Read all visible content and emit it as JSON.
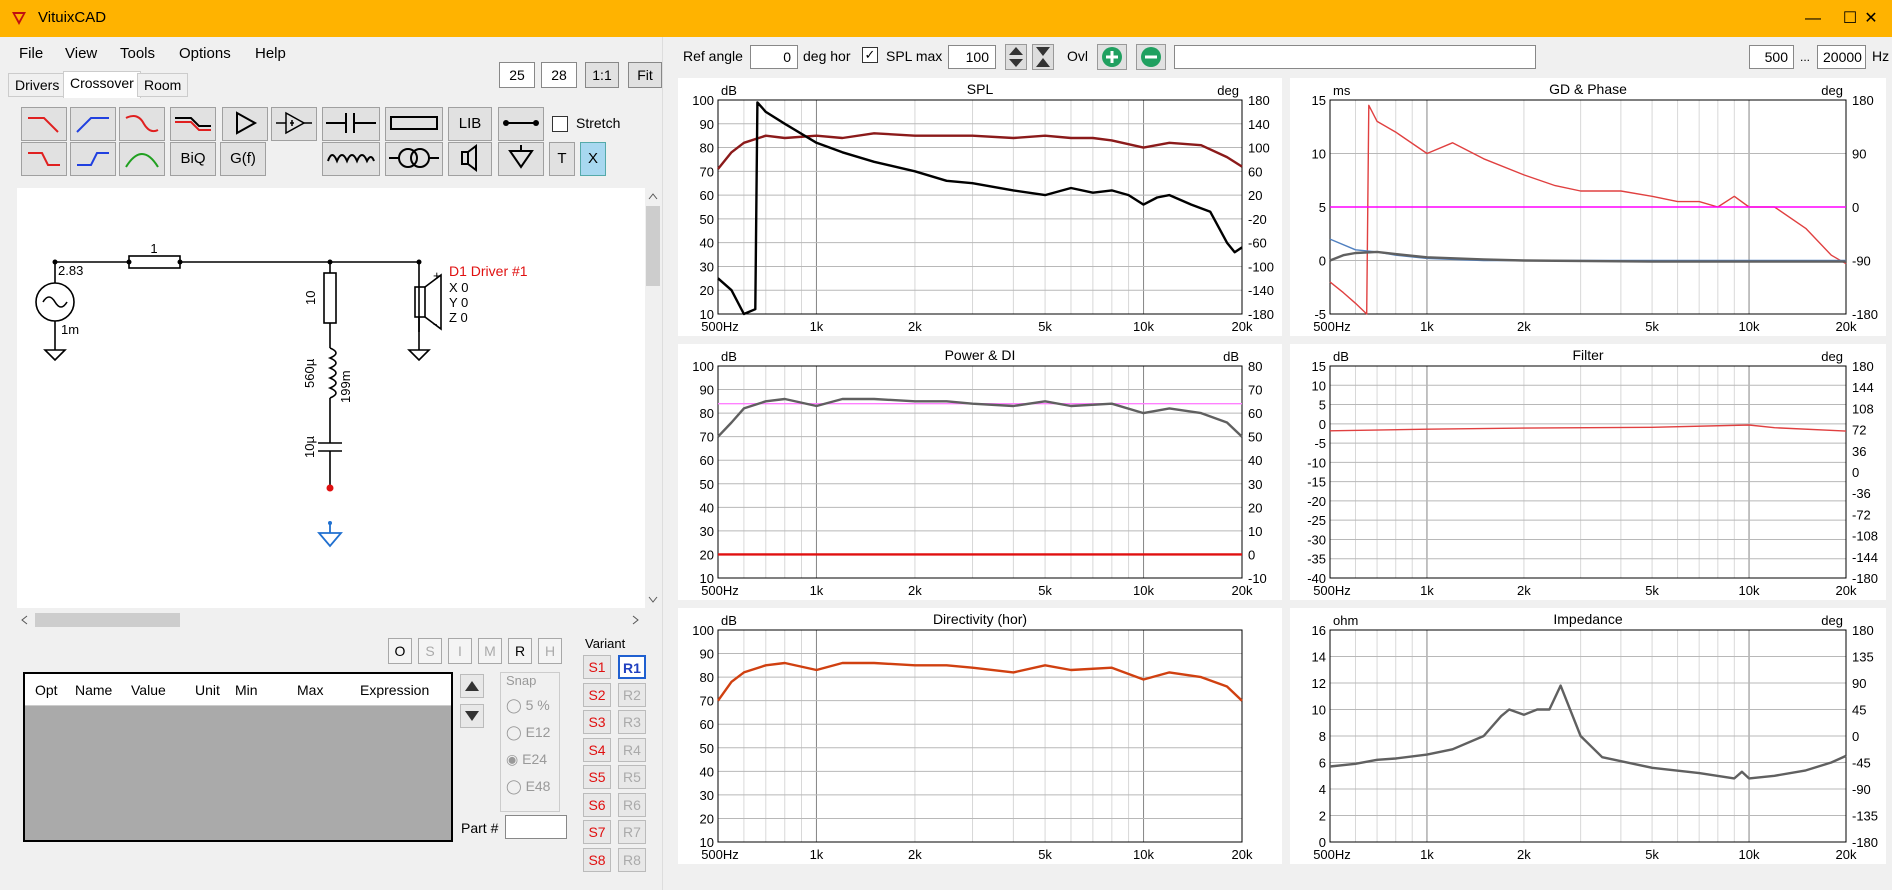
{
  "app": {
    "title": "VituixCAD",
    "brand_color": "#FFB300"
  },
  "window_controls": [
    "—",
    "☐",
    "✕"
  ],
  "menu": [
    "File",
    "View",
    "Tools",
    "Options",
    "Help"
  ],
  "tabs": [
    "Drivers",
    "Crossover",
    "Room"
  ],
  "active_tab": "Crossover",
  "view_boxes": {
    "a": "25",
    "b": "28",
    "one_to_one": "1:1",
    "fit": "Fit"
  },
  "toolbar": {
    "biq": "BiQ",
    "gf": "G(f)",
    "lib": "LIB",
    "t": "T",
    "x": "X",
    "stretch": "Stretch"
  },
  "schematic": {
    "source_voltage": "2.83",
    "source_impedance": "1m",
    "r_series": "1",
    "r_shunt": "10",
    "l_shunt": "560µ",
    "l_dcr": "199m",
    "c_shunt": "10µ",
    "driver": {
      "label": "D1 Driver #1",
      "x": "X 0",
      "y": "Y 0",
      "z": "Z 0",
      "plus": "+",
      "minus": "-"
    }
  },
  "mode_buttons": [
    "O",
    "S",
    "I",
    "M",
    "R",
    "H"
  ],
  "optimizer": {
    "columns": [
      "Opt",
      "Name",
      "Value",
      "Unit",
      "Min",
      "Max",
      "Expression"
    ]
  },
  "snap": {
    "label": "Snap",
    "options": [
      "5 %",
      "E12",
      "E24",
      "E48"
    ],
    "selected": "E24"
  },
  "part_label": "Part #",
  "variant": {
    "label": "Variant",
    "s": [
      "S1",
      "S2",
      "S3",
      "S4",
      "S5",
      "S6",
      "S7",
      "S8"
    ],
    "r": [
      "R1",
      "R2",
      "R3",
      "R4",
      "R5",
      "R6",
      "R7",
      "R8"
    ],
    "active_r": "R1"
  },
  "top_controls": {
    "ref_angle_label": "Ref angle",
    "ref_angle": "0",
    "deg_hor": "deg hor",
    "spl_max_label": "SPL max",
    "spl_max": "100",
    "ovl": "Ovl",
    "f_min": "500",
    "ellipsis": "...",
    "f_max": "20000",
    "hz": "Hz"
  },
  "freq_ticks": [
    "500Hz",
    "1k",
    "2k",
    "5k",
    "10k",
    "20k"
  ],
  "chart_data": [
    {
      "type": "line",
      "title": "SPL",
      "ylabel": "dB",
      "y2label": "deg",
      "ylim": [
        10,
        100
      ],
      "y2lim": [
        -180,
        180
      ],
      "y_ticks": [
        "100",
        "90",
        "80",
        "70",
        "60",
        "50",
        "40",
        "30",
        "20",
        "10"
      ],
      "y2_ticks": [
        "180",
        "140",
        "100",
        "60",
        "20",
        "-20",
        "-60",
        "-100",
        "-140",
        "-180"
      ],
      "series": [
        {
          "color": "#8B1A1A",
          "x": [
            500,
            550,
            600,
            700,
            800,
            1000,
            1200,
            1500,
            2000,
            2500,
            3000,
            4000,
            5000,
            6000,
            7000,
            8000,
            10000,
            12000,
            15000,
            18000,
            20000
          ],
          "values": [
            71,
            78,
            82,
            85,
            84,
            85,
            84,
            86,
            85,
            85,
            85,
            84,
            85,
            84,
            84,
            83,
            80,
            82,
            81,
            76,
            72
          ]
        },
        {
          "color": "#000000",
          "x": [
            500,
            550,
            600,
            650,
            660,
            700,
            800,
            1000,
            1200,
            1500,
            2000,
            2500,
            3000,
            4000,
            5000,
            6000,
            7000,
            8000,
            9000,
            10000,
            11000,
            12000,
            14000,
            16000,
            18000,
            19000,
            20000
          ],
          "values": [
            25,
            20,
            10,
            12,
            99,
            95,
            90,
            82,
            78,
            74,
            70,
            66,
            65,
            62,
            60,
            63,
            61,
            62,
            60,
            56,
            59,
            60,
            56,
            53,
            40,
            36,
            38
          ]
        }
      ]
    },
    {
      "type": "line",
      "title": "GD & Phase",
      "ylabel": "ms",
      "y2label": "deg",
      "ylim": [
        -5,
        15
      ],
      "y2lim": [
        -180,
        180
      ],
      "y_ticks": [
        "15",
        "10",
        "5",
        "0",
        "-5"
      ],
      "y2_ticks": [
        "180",
        "90",
        "0",
        "-90",
        "-180"
      ],
      "series": [
        {
          "color": "#E04040",
          "x": [
            500,
            550,
            600,
            650,
            660,
            700,
            800,
            1000,
            1200,
            1500,
            2000,
            2500,
            3000,
            4000,
            5000,
            6000,
            7000,
            8000,
            9000,
            10000,
            12000,
            15000,
            18000,
            20000
          ],
          "values": [
            -2,
            -3,
            -4,
            -5,
            14.5,
            13,
            12,
            10,
            11,
            9.5,
            8,
            7,
            6.5,
            6.5,
            6,
            5.5,
            5.5,
            5,
            6,
            5,
            5,
            3,
            0.5,
            -0.3
          ]
        },
        {
          "color": "#FF00FF",
          "x": [
            500,
            20000
          ],
          "values": [
            5,
            5
          ]
        },
        {
          "color": "#5080C0",
          "x": [
            500,
            600,
            700,
            800,
            1000,
            1500,
            2000,
            5000,
            20000
          ],
          "values": [
            2,
            1,
            0.8,
            0.5,
            0.2,
            0,
            0,
            0,
            0
          ]
        },
        {
          "color": "#606060",
          "x": [
            500,
            550,
            600,
            700,
            800,
            1000,
            1500,
            2000,
            5000,
            20000
          ],
          "values": [
            0,
            0.5,
            0.7,
            0.8,
            0.6,
            0.3,
            0.1,
            0,
            -0.1,
            -0.1
          ]
        }
      ]
    },
    {
      "type": "line",
      "title": "Power & DI",
      "ylabel": "dB",
      "y2label": "dB",
      "ylim": [
        10,
        100
      ],
      "y2lim": [
        -10,
        80
      ],
      "y_ticks": [
        "100",
        "90",
        "80",
        "70",
        "60",
        "50",
        "40",
        "30",
        "20",
        "10"
      ],
      "y2_ticks": [
        "80",
        "70",
        "60",
        "50",
        "40",
        "30",
        "20",
        "10",
        "0",
        "-10"
      ],
      "series": [
        {
          "color": "#FF80FF",
          "x": [
            500,
            20000
          ],
          "values": [
            84,
            84
          ]
        },
        {
          "color": "#606060",
          "x": [
            500,
            550,
            600,
            700,
            800,
            1000,
            1200,
            1500,
            2000,
            2500,
            3000,
            4000,
            5000,
            6000,
            8000,
            10000,
            12000,
            15000,
            18000,
            20000
          ],
          "values": [
            70,
            76,
            82,
            85,
            86,
            83,
            86,
            86,
            85,
            85,
            84,
            83,
            85,
            83,
            84,
            80,
            82,
            80,
            76,
            70
          ]
        },
        {
          "color": "#E01010",
          "x": [
            500,
            20000
          ],
          "values": [
            20,
            20
          ]
        }
      ]
    },
    {
      "type": "line",
      "title": "Filter",
      "ylabel": "dB",
      "y2label": "deg",
      "ylim": [
        -40,
        15
      ],
      "y2lim": [
        -180,
        180
      ],
      "y_ticks": [
        "15",
        "10",
        "5",
        "0",
        "-5",
        "-10",
        "-15",
        "-20",
        "-25",
        "-30",
        "-35",
        "-40"
      ],
      "y2_ticks": [
        "180",
        "144",
        "108",
        "72",
        "36",
        "0",
        "-36",
        "-72",
        "-108",
        "-144",
        "-180"
      ],
      "series": [
        {
          "color": "#E04040",
          "x": [
            500,
            1000,
            2000,
            5000,
            10000,
            12000,
            20000
          ],
          "values": [
            -1.8,
            -1.4,
            -1.1,
            -0.9,
            -0.3,
            -1,
            -1.9
          ]
        }
      ]
    },
    {
      "type": "line",
      "title": "Directivity (hor)",
      "ylabel": "dB",
      "ylim": [
        10,
        100
      ],
      "y_ticks": [
        "100",
        "90",
        "80",
        "70",
        "60",
        "50",
        "40",
        "30",
        "20",
        "10"
      ],
      "series": [
        {
          "color": "#D04010",
          "x": [
            500,
            550,
            600,
            700,
            800,
            1000,
            1200,
            1500,
            2000,
            2500,
            3000,
            4000,
            5000,
            6000,
            8000,
            10000,
            12000,
            15000,
            18000,
            20000
          ],
          "values": [
            70,
            78,
            82,
            85,
            86,
            83,
            86,
            86,
            85,
            85,
            84,
            82,
            85,
            83,
            84,
            79,
            82,
            80,
            76,
            70
          ]
        }
      ]
    },
    {
      "type": "line",
      "title": "Impedance",
      "ylabel": "ohm",
      "y2label": "deg",
      "ylim": [
        0,
        16
      ],
      "y2lim": [
        -180,
        180
      ],
      "y_ticks": [
        "16",
        "14",
        "12",
        "10",
        "8",
        "6",
        "4",
        "2",
        "0"
      ],
      "y2_ticks": [
        "180",
        "135",
        "90",
        "45",
        "0",
        "-45",
        "-90",
        "-135",
        "-180"
      ],
      "series": [
        {
          "color": "#606060",
          "x": [
            500,
            600,
            700,
            800,
            1000,
            1200,
            1500,
            1700,
            1800,
            2000,
            2200,
            2400,
            2600,
            3000,
            3500,
            5000,
            7000,
            9000,
            9500,
            10000,
            12000,
            15000,
            18000,
            20000
          ],
          "values": [
            5.7,
            5.9,
            6.2,
            6.3,
            6.6,
            7,
            8,
            9.5,
            10,
            9.6,
            10,
            10,
            11.8,
            8,
            6.4,
            5.6,
            5.2,
            4.8,
            5.3,
            4.8,
            5.0,
            5.4,
            6,
            6.5
          ]
        }
      ]
    }
  ]
}
